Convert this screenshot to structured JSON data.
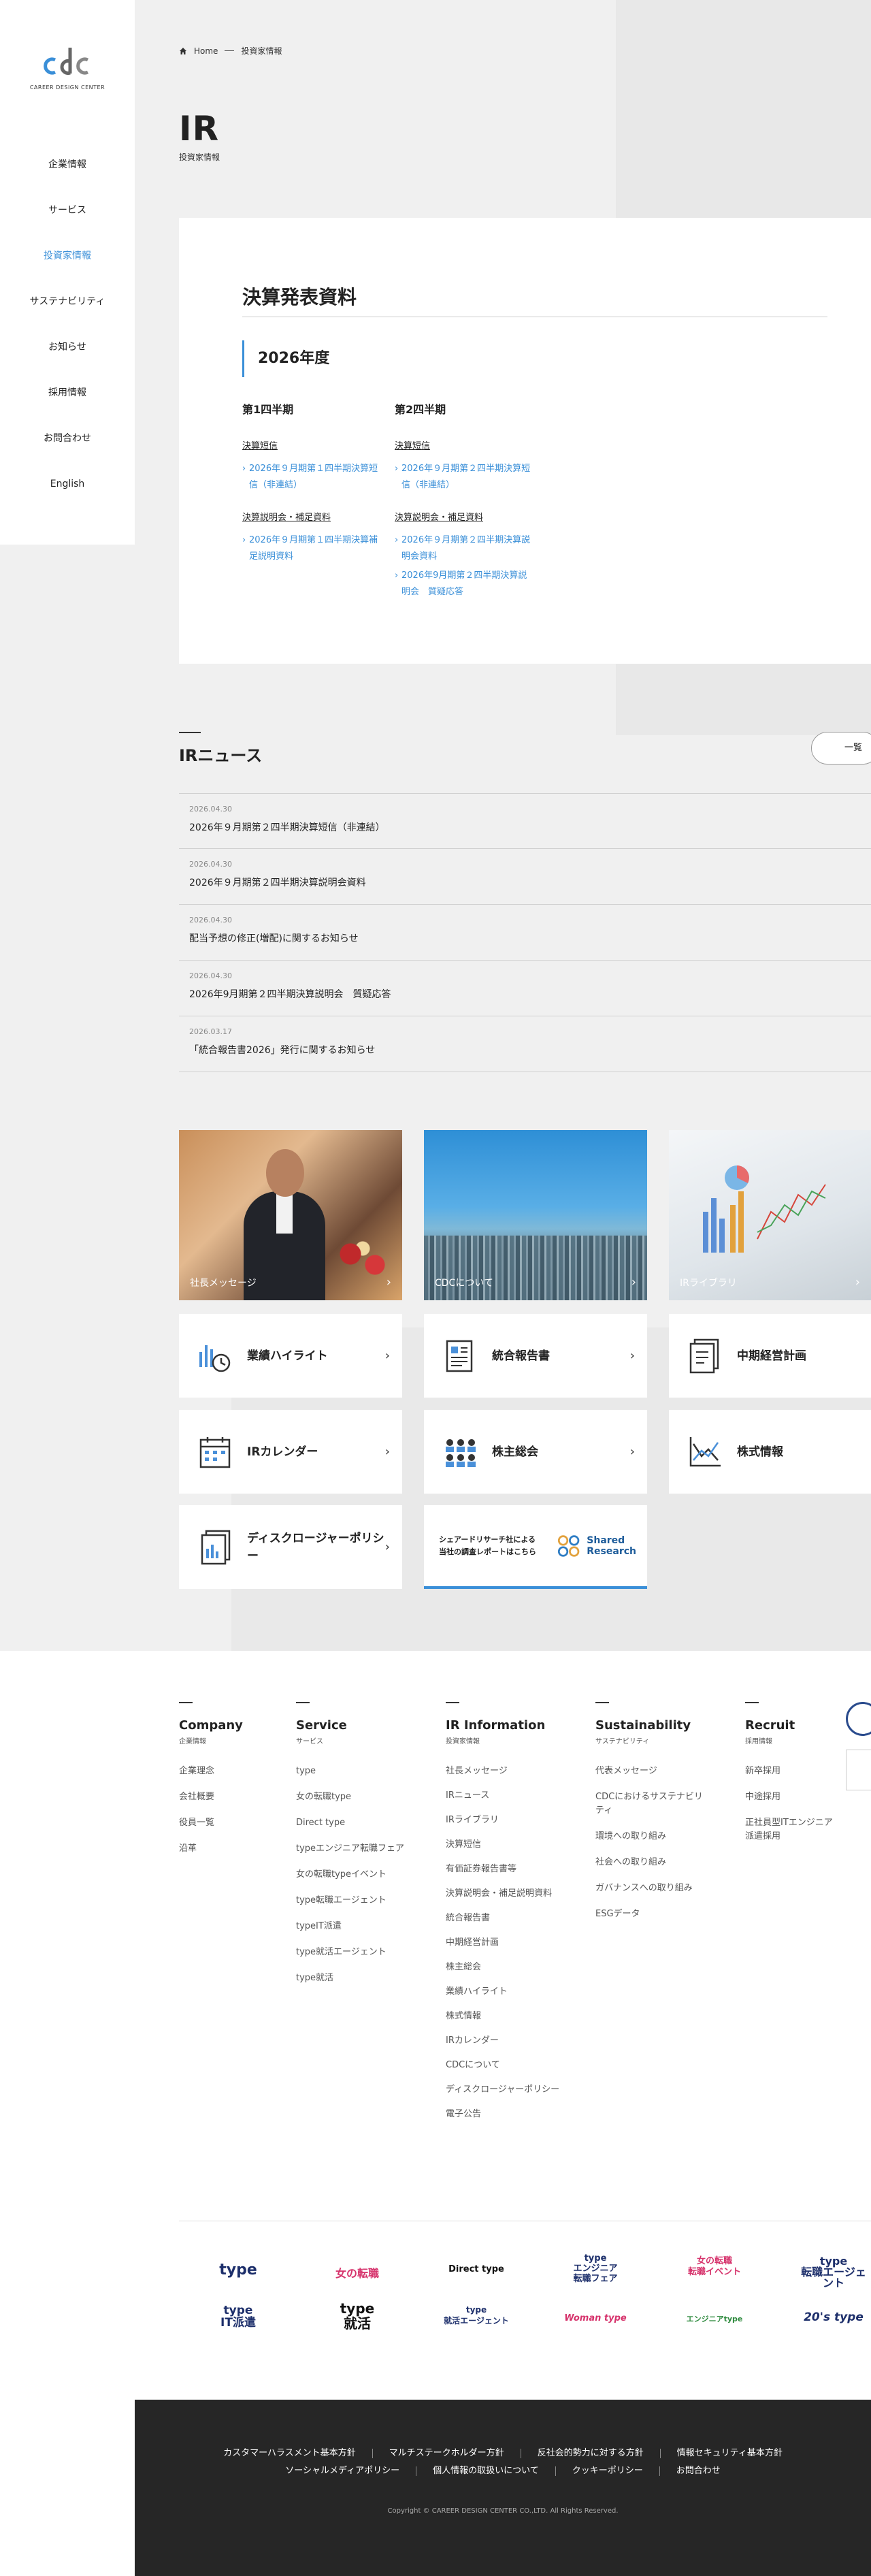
{
  "logo": {
    "mark": "cdc",
    "text": "CAREER DESIGN CENTER"
  },
  "nav": [
    {
      "label": "企業情報"
    },
    {
      "label": "サービス"
    },
    {
      "label": "投資家情報"
    },
    {
      "label": "サステナビリティ"
    },
    {
      "label": "お知らせ"
    },
    {
      "label": "採用情報"
    },
    {
      "label": "お問合わせ"
    },
    {
      "label": "English"
    }
  ],
  "breadcrumb": {
    "home": "Home",
    "current": "投資家情報"
  },
  "page": {
    "title": "IR",
    "subtitle": "投資家情報"
  },
  "results": {
    "title": "決算発表資料",
    "year": "2026年度",
    "quarters": [
      {
        "title": "第1四半期",
        "head1": "決算短信",
        "links1": [
          "2026年９月期第１四半期決算短信（非連結）"
        ],
        "head2": "決算説明会・補足資料",
        "links2": [
          "2026年９月期第１四半期決算補足説明資料"
        ]
      },
      {
        "title": "第2四半期",
        "head1": "決算短信",
        "links1": [
          "2026年９月期第２四半期決算短信（非連結）"
        ],
        "head2": "決算説明会・補足資料",
        "links2": [
          "2026年９月期第２四半期決算説明会資料",
          "2026年9月期第２四半期決算説明会　質疑応答"
        ]
      }
    ]
  },
  "news": {
    "title": "IRニュース",
    "list_button": "一覧",
    "items": [
      {
        "date": "2026.04.30",
        "text": "2026年９月期第２四半期決算短信（非連結）"
      },
      {
        "date": "2026.04.30",
        "text": "2026年９月期第２四半期決算説明会資料"
      },
      {
        "date": "2026.04.30",
        "text": "配当予想の修正(増配)に関するお知らせ"
      },
      {
        "date": "2026.04.30",
        "text": "2026年9月期第２四半期決算説明会　質疑応答"
      },
      {
        "date": "2026.03.17",
        "text": "「統合報告書2026」発行に関するお知らせ"
      }
    ]
  },
  "photo_tiles": [
    {
      "label": "社長メッセージ"
    },
    {
      "label": "CDCについて"
    },
    {
      "label": "IRライブラリ"
    }
  ],
  "link_tiles": [
    {
      "label": "業績ハイライト",
      "icon": "performance-chart-icon"
    },
    {
      "label": "統合報告書",
      "icon": "report-icon"
    },
    {
      "label": "中期経営計画",
      "icon": "plan-document-icon"
    },
    {
      "label": "IRカレンダー",
      "icon": "calendar-icon"
    },
    {
      "label": "株主総会",
      "icon": "meeting-icon"
    },
    {
      "label": "株式情報",
      "icon": "stock-chart-icon"
    },
    {
      "label": "ディスクロージャーポリシー",
      "icon": "disclosure-document-icon"
    }
  ],
  "shared_research": {
    "line1": "シェアードリサーチ社による",
    "line2": "当社の調査レポートはこちら",
    "logo1": "Shared",
    "logo2": "Research"
  },
  "footer_cols": [
    {
      "title": "Company",
      "sub": "企業情報",
      "links": [
        "企業理念",
        "会社概要",
        "役員一覧",
        "沿革"
      ]
    },
    {
      "title": "Service",
      "sub": "サービス",
      "links": [
        "type",
        "女の転職type",
        "Direct type",
        "typeエンジニア転職フェア",
        "女の転職typeイベント",
        "type転職エージェント",
        "typeIT派遣",
        "type就活エージェント",
        "type就活"
      ]
    },
    {
      "title": "IR Information",
      "sub": "投資家情報",
      "links": [
        "社長メッセージ",
        "IRニュース",
        "IRライブラリ",
        "決算短信",
        "有価証券報告書等",
        "決算説明会・補足説明資料",
        "統合報告書",
        "中期経営計画",
        "株主総会",
        "業績ハイライト",
        "株式情報",
        "IRカレンダー",
        "CDCについて",
        "ディスクロージャーポリシー",
        "電子公告"
      ]
    },
    {
      "title": "Sustainability",
      "sub": "サステナビリティ",
      "links": [
        "代表メッセージ",
        "CDCにおけるサステナビリティ",
        "環境への取り組み",
        "社会への取り組み",
        "ガバナンスへの取り組み",
        "ESGデータ"
      ]
    },
    {
      "title": "Recruit",
      "sub": "採用情報",
      "links": [
        "新卒採用",
        "中途採用",
        "正社員型ITエンジニア派遣採用"
      ]
    }
  ],
  "brands": {
    "row1": [
      "type",
      "女の転職",
      "Direct type",
      "type\nエンジニア\n転職フェア",
      "女の転職\n転職イベント",
      "type\n転職エージェント"
    ],
    "row2": [
      "type\nIT派遣",
      "type\n就活",
      "type\n就活エージェント",
      "Woman type",
      "エンジニアtype",
      "20's type"
    ]
  },
  "footer_links": {
    "row1": [
      "カスタマーハラスメント基本方針",
      "マルチステークホルダー方針",
      "反社会的勢力に対する方針",
      "情報セキュリティ基本方針"
    ],
    "row2": [
      "ソーシャルメディアポリシー",
      "個人情報の取扱いについて",
      "クッキーポリシー",
      "お問合わせ"
    ]
  },
  "copyright": "Copyright © CAREER DESIGN CENTER CO.,LTD. All Rights Reserved.",
  "colors": {
    "accent": "#3a8fd8",
    "dark_footer": "#262626",
    "bg_gray": "#f0f0f0"
  }
}
